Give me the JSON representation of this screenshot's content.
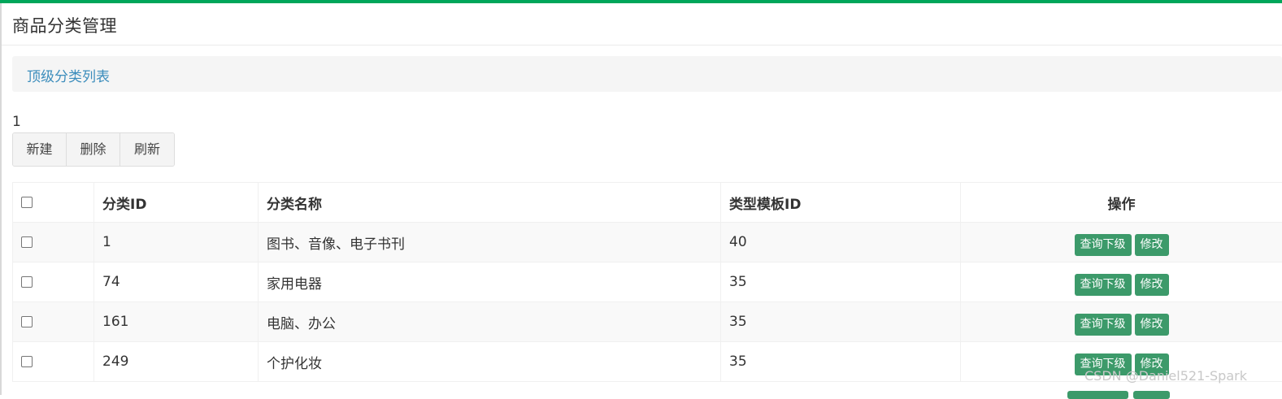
{
  "page": {
    "title": "商品分类管理",
    "breadcrumb": "顶级分类列表",
    "selected_count": "1"
  },
  "toolbar": {
    "new_label": "新建",
    "delete_label": "删除",
    "refresh_label": "刷新"
  },
  "table": {
    "headers": {
      "id": "分类ID",
      "name": "分类名称",
      "template": "类型模板ID",
      "operation": "操作"
    },
    "rows": [
      {
        "id": "1",
        "name": "图书、音像、电子书刊",
        "template": "40"
      },
      {
        "id": "74",
        "name": "家用电器",
        "template": "35"
      },
      {
        "id": "161",
        "name": "电脑、办公",
        "template": "35"
      },
      {
        "id": "249",
        "name": "个护化妆",
        "template": "35"
      }
    ],
    "row_actions": {
      "query_children": "查询下级",
      "edit": "修改"
    }
  },
  "watermark": "CSDN @Daniel521-Spark",
  "colors": {
    "accent_bar": "#00a65a",
    "link": "#3c8dbc",
    "action_button": "#3c9a6a"
  }
}
